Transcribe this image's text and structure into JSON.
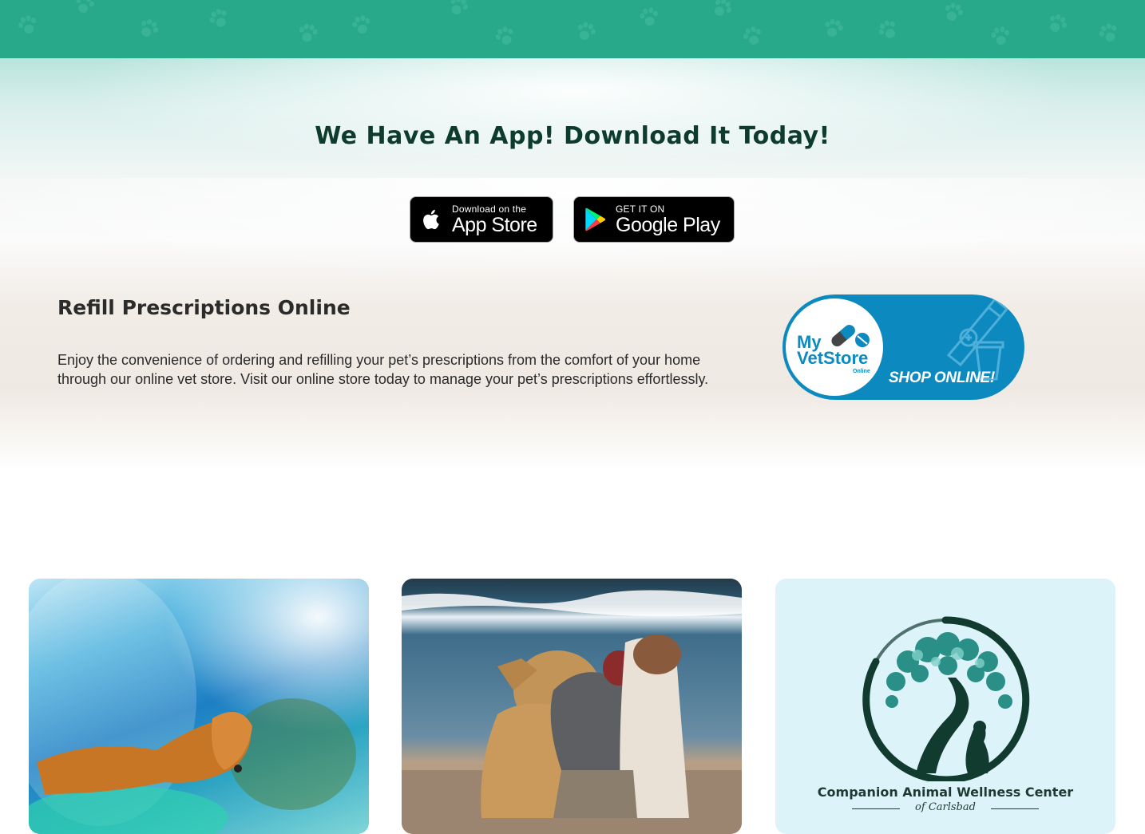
{
  "hero": {
    "app_title": "We Have An App! Download It Today!",
    "app_store": {
      "small": "Download on the",
      "big": "App Store",
      "icon": "apple-icon"
    },
    "google_play": {
      "small": "GET IT ON",
      "big": "Google Play",
      "icon": "google-play-icon"
    }
  },
  "refill": {
    "title": "Refill Prescriptions Online",
    "body": "Enjoy the convenience of ordering and refilling your pet’s prescriptions from the comfort of your home through our online vet store.  Visit our online store today to manage your pet’s prescriptions effortlessly."
  },
  "vetstore": {
    "logo_my": "My",
    "logo_vetstore": "VetStore",
    "logo_online": "Online",
    "shop_label": "SHOP ONLINE!"
  },
  "cards": {
    "logo_name": "Companion Animal Wellness Center",
    "logo_sub": "of Carlsbad"
  },
  "colors": {
    "top_band": "#27a98a",
    "title_text": "#0d3b2c",
    "vetstore_blue": "#0c8ac0",
    "logo_green": "#1d3a33"
  }
}
